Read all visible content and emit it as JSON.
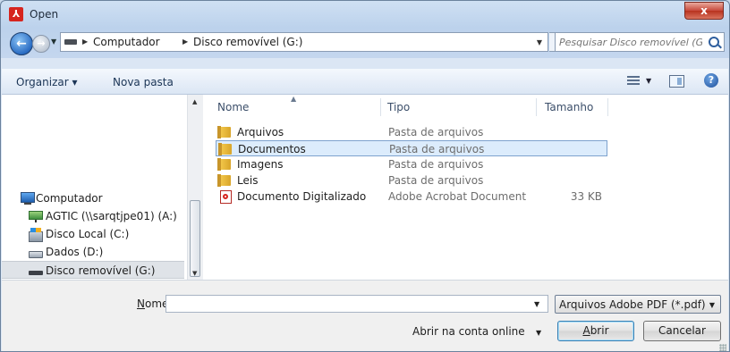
{
  "window": {
    "title": "Open",
    "app_icon": "pdf-app-icon",
    "close_symbol": "x"
  },
  "address": {
    "breadcrumb": [
      "Computador",
      "Disco removível (G:)"
    ],
    "search_placeholder": "Pesquisar Disco removível (G:)"
  },
  "toolbar": {
    "organize_label": "Organizar ▾",
    "new_folder_label": "Nova pasta"
  },
  "nav": {
    "items": [
      {
        "label": "Computador",
        "icon": "computer-icon"
      },
      {
        "label": "AGTIC (\\\\sarqtjpe01) (A:)",
        "icon": "network-drive-icon"
      },
      {
        "label": "Disco Local (C:)",
        "icon": "local-disk-icon"
      },
      {
        "label": "Dados (D:)",
        "icon": "disk-icon"
      },
      {
        "label": "Disco removível (G:)",
        "icon": "removable-disk-icon",
        "selected": true
      }
    ]
  },
  "files": {
    "columns": [
      "Nome",
      "Tipo",
      "Tamanho"
    ],
    "rows": [
      {
        "name": "Arquivos",
        "type": "Pasta de arquivos",
        "size": "",
        "icon": "folder-icon"
      },
      {
        "name": "Documentos",
        "type": "Pasta de arquivos",
        "size": "",
        "icon": "folder-icon",
        "selected": true
      },
      {
        "name": "Imagens",
        "type": "Pasta de arquivos",
        "size": "",
        "icon": "folder-icon"
      },
      {
        "name": "Leis",
        "type": "Pasta de arquivos",
        "size": "",
        "icon": "folder-icon"
      },
      {
        "name": "Documento Digitalizado",
        "type": "Adobe Acrobat Document",
        "size": "33 KB",
        "icon": "pdf-file-icon"
      }
    ]
  },
  "footer": {
    "name_label_first": "N",
    "name_label_rest": "ome:",
    "name_value": "",
    "filetype_selected": "Arquivos Adobe PDF (*.pdf)",
    "online_label": "Abrir na conta online",
    "open_first": "A",
    "open_rest": "brir",
    "cancel_label": "Cancelar"
  }
}
